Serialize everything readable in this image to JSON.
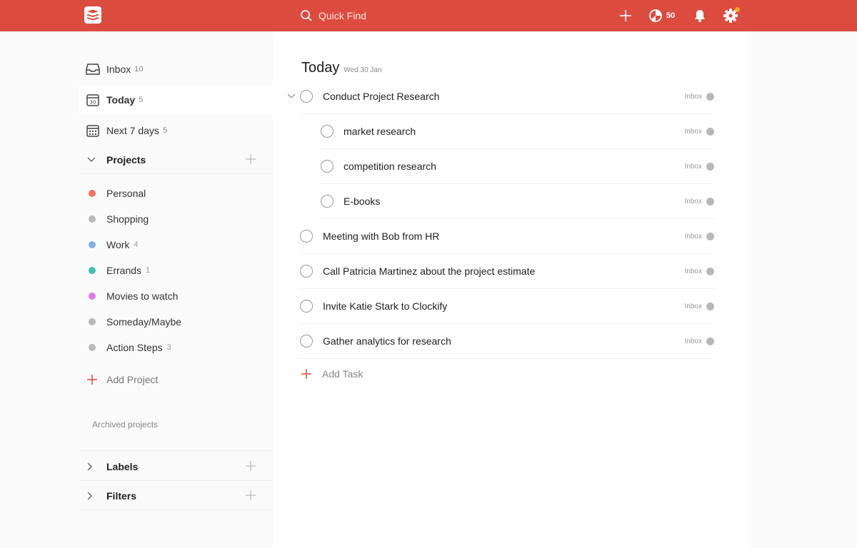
{
  "colors": {
    "brand": "#db4c3f",
    "accent_dot": "#f9a825"
  },
  "topbar": {
    "search_placeholder": "Quick Find",
    "karma_count": "50",
    "icons": [
      "todoist-logo-icon",
      "search-icon",
      "plus-icon",
      "karma-icon",
      "bell-icon",
      "gear-icon"
    ]
  },
  "sidebar": {
    "nav": [
      {
        "label": "Inbox",
        "count": "10",
        "icon": "inbox-icon"
      },
      {
        "label": "Today",
        "count": "5",
        "icon": "calendar-today-icon"
      },
      {
        "label": "Next 7 days",
        "count": "5",
        "icon": "calendar-week-icon"
      }
    ],
    "projects_title": "Projects",
    "projects": [
      {
        "label": "Personal",
        "count": "",
        "color": "#f0725f"
      },
      {
        "label": "Shopping",
        "count": "",
        "color": "#b8b8b8"
      },
      {
        "label": "Work",
        "count": "4",
        "color": "#7fb3e5"
      },
      {
        "label": "Errands",
        "count": "1",
        "color": "#3fbfb0"
      },
      {
        "label": "Movies to watch",
        "count": "",
        "color": "#e07ae8"
      },
      {
        "label": "Someday/Maybe",
        "count": "",
        "color": "#b8b8b8"
      },
      {
        "label": "Action Steps",
        "count": "3",
        "color": "#b8b8b8"
      }
    ],
    "add_project": "Add Project",
    "archived": "Archived projects",
    "labels_title": "Labels",
    "filters_title": "Filters"
  },
  "main": {
    "title": "Today",
    "date": "Wed 30 Jan",
    "tasks": [
      {
        "content": "Conduct Project Research",
        "project": "Inbox"
      },
      {
        "content": "market research",
        "project": "Inbox"
      },
      {
        "content": "competition research",
        "project": "Inbox"
      },
      {
        "content": "E-books",
        "project": "Inbox"
      },
      {
        "content": "Meeting with Bob from HR",
        "project": "Inbox"
      },
      {
        "content": "Call Patricia Martinez about the project estimate",
        "project": "Inbox"
      },
      {
        "content": "Invite Katie Stark to Clockify",
        "project": "Inbox"
      },
      {
        "content": "Gather analytics for research",
        "project": "Inbox"
      }
    ],
    "add_task": "Add Task"
  }
}
